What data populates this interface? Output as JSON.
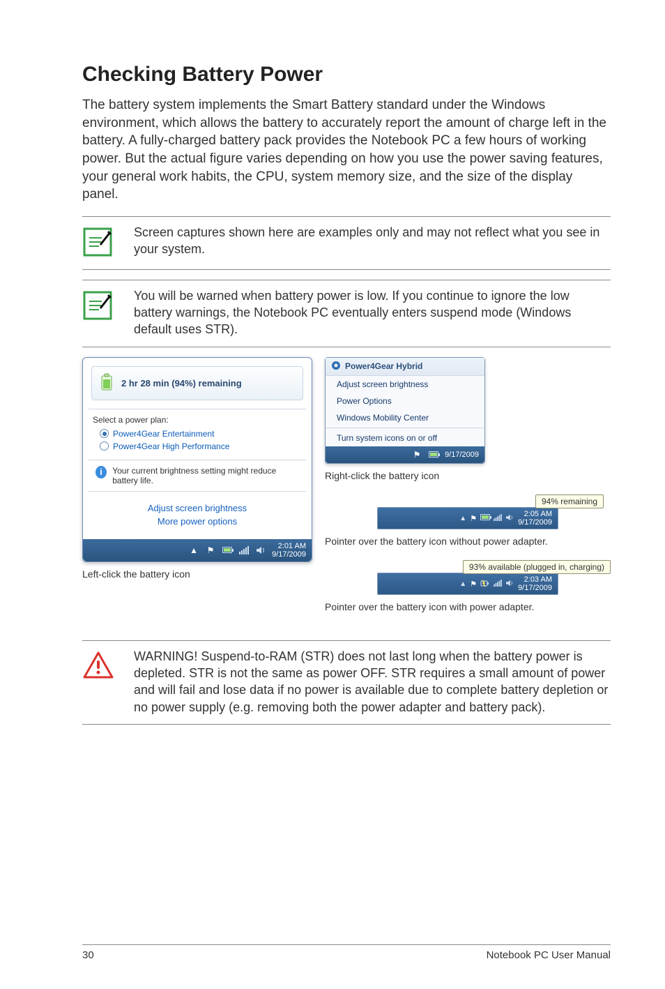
{
  "page": {
    "title": "Checking Battery Power",
    "intro": "The battery system implements the Smart Battery standard under the Windows environment, which allows the battery to accurately report the amount of charge left in the battery. A fully-charged battery pack provides the Notebook PC a few hours of working power. But the actual figure varies depending on how you use the power saving features, your general work habits, the CPU, system memory size, and the size of the display panel.",
    "note1": "Screen captures shown here are examples only and may not reflect what you see in your system.",
    "note2": "You will be warned when battery power is low. If you continue to ignore the low battery warnings, the Notebook PC eventually enters suspend mode (Windows default uses STR).",
    "warning": "WARNING!  Suspend-to-RAM (STR) does not last long when the battery power is depleted. STR is not the same as power OFF. STR requires a small amount of power and will fail and lose data if no power is available due to complete battery depletion or no power supply (e.g. removing both the power adapter and battery pack).",
    "footer_page": "30",
    "footer_doc": "Notebook PC User Manual"
  },
  "popup": {
    "status": "2 hr 28 min (94%) remaining",
    "plan_label": "Select a power plan:",
    "plan1": "Power4Gear Entertainment",
    "plan2": "Power4Gear High Performance",
    "hint": "Your current brightness setting might reduce battery life.",
    "link1": "Adjust screen brightness",
    "link2": "More power options",
    "tray_time": "2:01 AM",
    "tray_date": "9/17/2009"
  },
  "captions": {
    "left": "Left-click the battery icon",
    "right_context": "Right-click the battery icon",
    "right_noadapter": "Pointer over the battery icon without power adapter.",
    "right_adapter": "Pointer over the battery icon with power adapter."
  },
  "context_menu": {
    "title": "Power4Gear Hybrid",
    "item1": "Adjust screen brightness",
    "item2": "Power Options",
    "item3": "Windows Mobility Center",
    "item4": "Turn system icons on or off",
    "tray_date": "9/17/2009"
  },
  "tooltip1": "94% remaining",
  "tray1": {
    "time": "2:05 AM",
    "date": "9/17/2009"
  },
  "tooltip2": "93% available (plugged in, charging)",
  "tray2": {
    "time": "2:03 AM",
    "date": "9/17/2009"
  }
}
